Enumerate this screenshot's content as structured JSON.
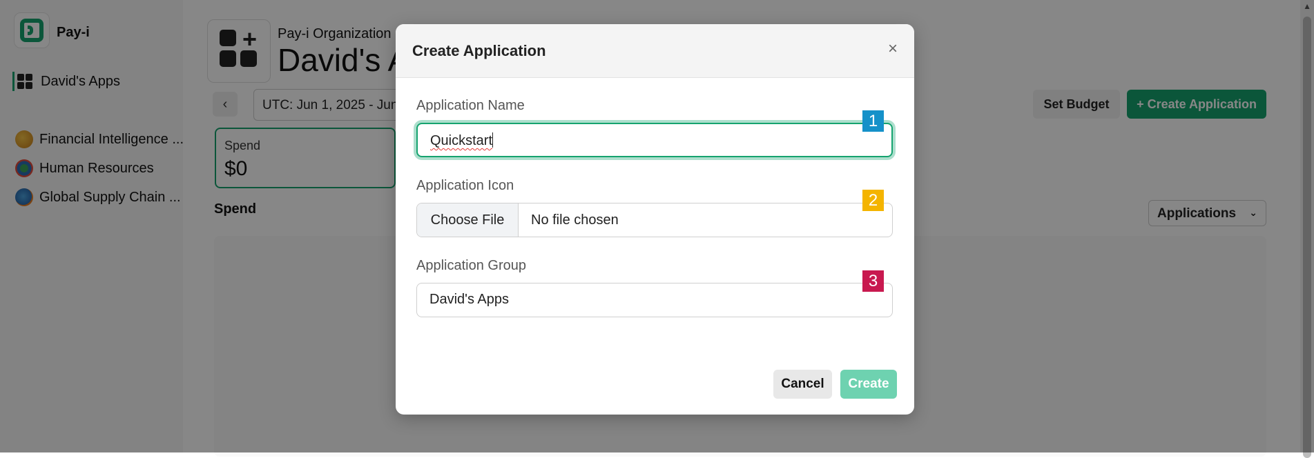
{
  "sidebar": {
    "brand": "Pay-i",
    "active_item": "David's Apps",
    "apps": [
      {
        "label": "Financial Intelligence ...",
        "icon": "finance-app-icon"
      },
      {
        "label": "Human Resources",
        "icon": "hr-app-icon"
      },
      {
        "label": "Global Supply Chain ...",
        "icon": "globe-app-icon"
      }
    ]
  },
  "main": {
    "org_name": "Pay-i Organization",
    "page_title": "David's Apps",
    "date_range": "UTC: Jun 1, 2025 - Jun",
    "set_budget_label": "Set Budget",
    "create_application_label": "+ Create Application",
    "spend_card": {
      "title": "Spend",
      "value": "$0"
    },
    "section_title": "Spend",
    "group_select": "Applications"
  },
  "modal": {
    "title": "Create Application",
    "close_glyph": "×",
    "name_label": "Application Name",
    "name_value": "Quickstart",
    "icon_label": "Application Icon",
    "file_button": "Choose File",
    "file_status": "No file chosen",
    "group_label": "Application Group",
    "group_value": "David's Apps",
    "cancel_label": "Cancel",
    "create_label": "Create"
  },
  "badges": [
    {
      "text": "1",
      "color": "#1591c9"
    },
    {
      "text": "2",
      "color": "#f4b400"
    },
    {
      "text": "3",
      "color": "#c8194f"
    }
  ],
  "colors": {
    "accent": "#15a36f",
    "create_disabled": "#6ed2b0"
  }
}
